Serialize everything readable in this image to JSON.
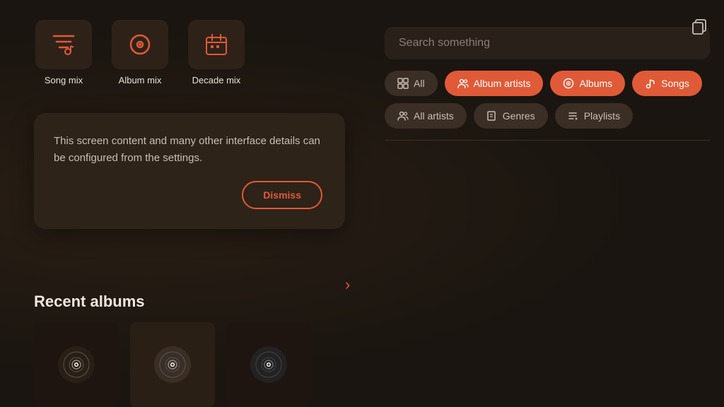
{
  "background": "#1a1510",
  "copy_icon": "⧉",
  "search": {
    "placeholder": "Search something"
  },
  "mix_cards": [
    {
      "id": "song-mix",
      "label": "Song mix",
      "icon": "song-mix"
    },
    {
      "id": "album-mix",
      "label": "Album mix",
      "icon": "album-mix"
    },
    {
      "id": "decade-mix",
      "label": "Decade mix",
      "icon": "decade-mix"
    }
  ],
  "info_box": {
    "text": "This screen content and many other interface details can be configured from the settings.",
    "dismiss_label": "Dismiss"
  },
  "filter_chips": [
    {
      "id": "all",
      "label": "All",
      "icon": "grid",
      "active": false
    },
    {
      "id": "album-artists",
      "label": "Album artists",
      "icon": "people",
      "active": true
    },
    {
      "id": "albums",
      "label": "Albums",
      "icon": "vinyl",
      "active": true
    },
    {
      "id": "songs",
      "label": "Songs",
      "icon": "music-note",
      "active": true
    },
    {
      "id": "all-artists",
      "label": "All artists",
      "icon": "people",
      "active": false
    },
    {
      "id": "genres",
      "label": "Genres",
      "icon": "book",
      "active": false
    },
    {
      "id": "playlists",
      "label": "Playlists",
      "icon": "playlist",
      "active": false
    }
  ],
  "recent_albums": {
    "title": "Recent albums"
  },
  "chevron": "›"
}
